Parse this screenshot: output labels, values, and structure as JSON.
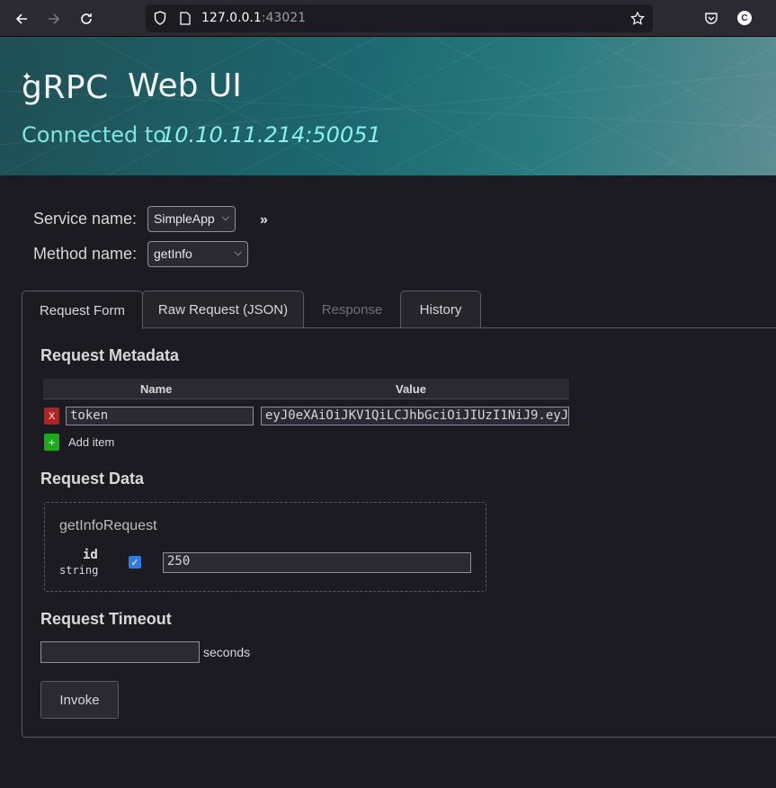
{
  "browser": {
    "url_host": "127.0.0.1",
    "url_port": ":43021",
    "avatar_letter": "C",
    "icons": [
      "back-icon",
      "forward-icon",
      "reload-icon",
      "shield-icon",
      "page-icon",
      "bookmark-star-icon",
      "pocket-icon",
      "account-icon"
    ]
  },
  "header": {
    "logo": "gRPC",
    "title": "Web UI",
    "connected_label": "Connected to",
    "connected_address": "10.10.11.214:50051"
  },
  "selectors": {
    "service_label": "Service name:",
    "service_value": "SimpleApp",
    "method_label": "Method name:",
    "method_value": "getInfo",
    "expand_glyph": "»"
  },
  "tabs": [
    {
      "label": "Request Form",
      "state": "active"
    },
    {
      "label": "Raw Request (JSON)",
      "state": "normal"
    },
    {
      "label": "Response",
      "state": "disabled"
    },
    {
      "label": "History",
      "state": "normal"
    }
  ],
  "metadata": {
    "title": "Request Metadata",
    "col_name": "Name",
    "col_value": "Value",
    "rows": [
      {
        "delete_label": "X",
        "name": "token",
        "value": "eyJ0eXAiOiJKV1QiLCJhbGciOiJIUzI1NiJ9.eyJ"
      }
    ],
    "add_glyph": "+",
    "add_label": "Add item"
  },
  "request_data": {
    "title": "Request Data",
    "message_name": "getInfoRequest",
    "fields": [
      {
        "name": "id",
        "type": "string",
        "checked": true,
        "value": "250"
      }
    ]
  },
  "timeout": {
    "title": "Request Timeout",
    "value": "",
    "unit": "seconds"
  },
  "invoke_label": "Invoke",
  "colors": {
    "accent_teal": "#1d6870",
    "connected_text": "#7fe4e2",
    "delete_red": "#b52020",
    "add_green": "#1ea81e",
    "checkbox_blue": "#2f7de1"
  }
}
